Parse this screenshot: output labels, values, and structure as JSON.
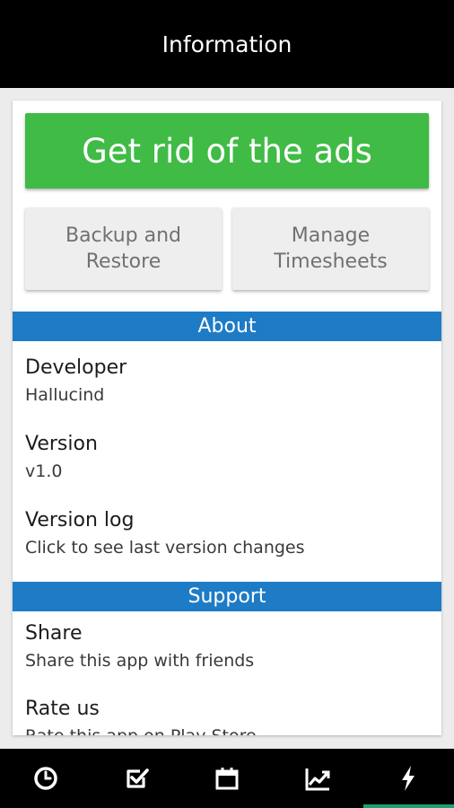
{
  "app_bar": {
    "title": "Information"
  },
  "buttons": {
    "remove_ads": "Get rid of the ads",
    "backup_restore": "Backup and Restore",
    "manage_timesheets": "Manage Timesheets"
  },
  "about": {
    "header": "About",
    "items": [
      {
        "title": "Developer",
        "subtitle": "Hallucind"
      },
      {
        "title": "Version",
        "subtitle": "v1.0"
      },
      {
        "title": "Version log",
        "subtitle": "Click to see last version changes"
      }
    ]
  },
  "support": {
    "header": "Support",
    "items": [
      {
        "title": "Share",
        "subtitle": "Share this app with friends"
      },
      {
        "title": "Rate us",
        "subtitle": "Rate this app on Play Store"
      }
    ]
  },
  "bottom_nav": [
    {
      "icon": "clock-icon",
      "active": false
    },
    {
      "icon": "checkbox-icon",
      "active": false
    },
    {
      "icon": "calendar-icon",
      "active": false
    },
    {
      "icon": "chart-icon",
      "active": false
    },
    {
      "icon": "lightning-icon",
      "active": true
    }
  ],
  "colors": {
    "app_bar": "#000000",
    "ads_button": "#40bb46",
    "section_header": "#1e7bc6",
    "secondary_button": "#eeeeee",
    "active_tab_indicator": "#1d9e74"
  }
}
